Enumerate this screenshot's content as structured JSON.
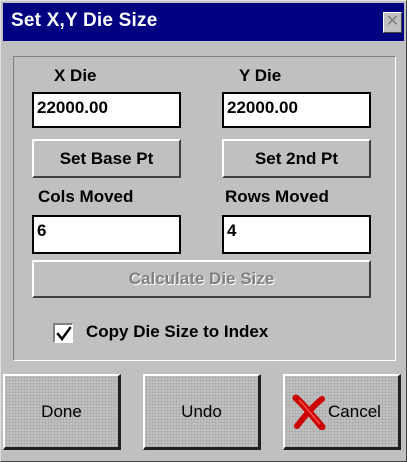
{
  "window": {
    "title": "Set X,Y Die Size",
    "close_glyph": "✕"
  },
  "x_die": {
    "label": "X Die",
    "value": "22000.00"
  },
  "y_die": {
    "label": "Y Die",
    "value": "22000.00"
  },
  "set_base_pt": "Set Base Pt",
  "set_2nd_pt": "Set 2nd Pt",
  "cols_moved": {
    "label": "Cols Moved",
    "value": "6"
  },
  "rows_moved": {
    "label": "Rows Moved",
    "value": "4"
  },
  "calculate": {
    "label": "Calculate Die Size",
    "enabled": false
  },
  "copy_to_index": {
    "label": "Copy Die Size to Index",
    "checked": true,
    "mark": "✓"
  },
  "buttons": {
    "done": "Done",
    "undo": "Undo",
    "cancel": "Cancel"
  },
  "colors": {
    "title_bar": "#000080",
    "face": "#c0c0c0",
    "cancel_x": "#cc0000"
  },
  "icons": [
    "close-icon",
    "check-icon",
    "cancel-x-icon"
  ]
}
